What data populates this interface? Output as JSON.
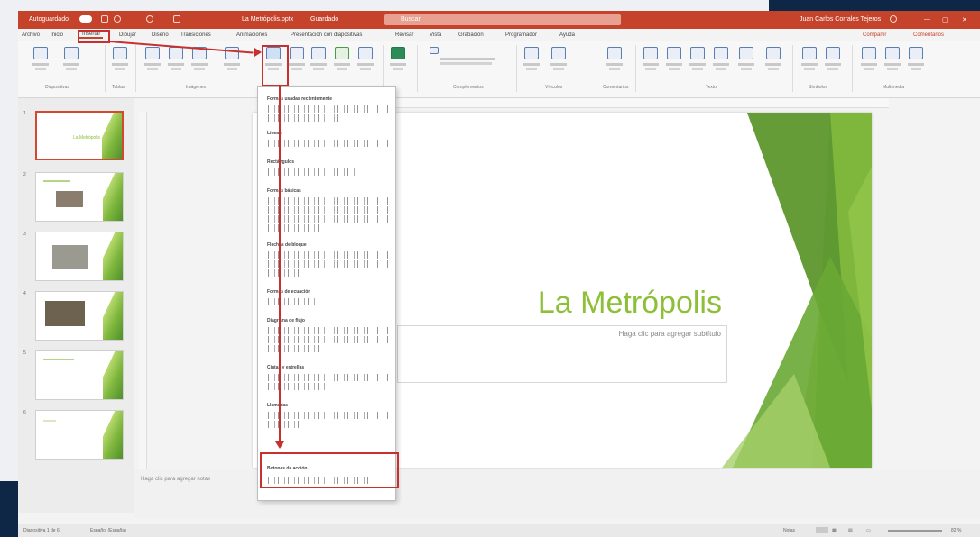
{
  "titlebar": {
    "autosave": "Autoguardado",
    "filename": "La Metrópolis.pptx",
    "saved": "Guardado",
    "search": "Buscar",
    "user": "Juan Carlos Corrales Tejeros"
  },
  "tabs": [
    "Archivo",
    "Inicio",
    "Insertar",
    "Dibujar",
    "Diseño",
    "Transiciones",
    "Animaciones",
    "Presentación con diapositivas",
    "Revisar",
    "Vista",
    "Grabación",
    "Programador",
    "Ayuda"
  ],
  "ribbon": {
    "buttons": [
      "Nueva diapositiva",
      "Volver a usar diapositivas",
      "Tabla",
      "Imágenes",
      "Imágenes en línea",
      "Capturas",
      "Álbum de fotografías",
      "Formas",
      "Iconos",
      "Modelos 3D",
      "SmartArt",
      "Gráfico",
      "Formularios",
      "Mis complementos",
      "Vínculo",
      "Acción",
      "Comentario",
      "Cuadro de texto",
      "Encabezado pie pág.",
      "WordArt",
      "Fecha y hora",
      "Número de diapositiva",
      "Objeto",
      "Ecuación",
      "Símbolo",
      "Vídeo",
      "Audio",
      "Grabación de pantalla"
    ],
    "groups": [
      "Diapositivas",
      "Tablas",
      "Imágenes",
      "Complementos",
      "Vínculos",
      "Comentarios",
      "Texto",
      "Símbolos",
      "Multimedia"
    ],
    "share": "Compartir",
    "comments": "Comentarios"
  },
  "dropdown": {
    "categories": [
      "Formas usadas recientemente",
      "Líneas",
      "Rectángulos",
      "Formas básicas",
      "Flechas de bloque",
      "Formas de ecuación",
      "Diagrama de flujo",
      "Cintas y estrellas",
      "Llamadas",
      "Botones de acción"
    ]
  },
  "slide": {
    "title": "La Metrópolis",
    "subtitle": "Haga clic para agregar subtítulo"
  },
  "thumb_title": "La Metrópolis",
  "notes": "Haga clic para agregar notas",
  "status": {
    "slide": "Diapositiva 1 de 6",
    "language": "Español (España)",
    "notes": "Notas",
    "zoom": "82 %"
  },
  "colors": {
    "accent": "#c4432a",
    "slide_title": "#8dbf38",
    "highlight": "#c6302e"
  }
}
